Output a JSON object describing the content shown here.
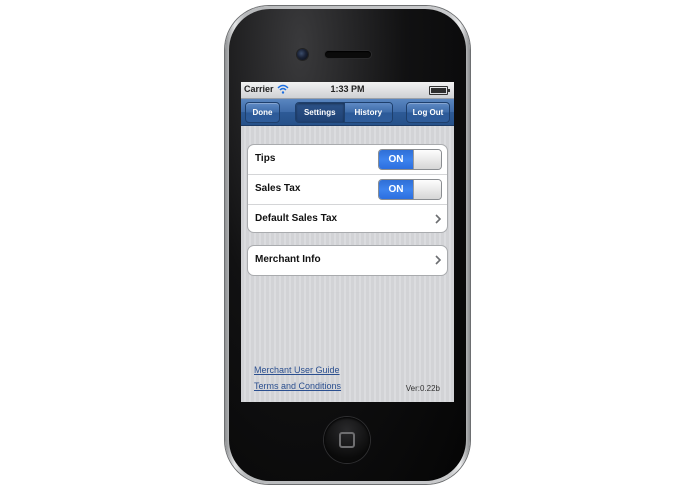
{
  "status_bar": {
    "carrier": "Carrier",
    "time": "1:33 PM"
  },
  "nav": {
    "done_label": "Done",
    "segments": [
      {
        "label": "Settings",
        "selected": true
      },
      {
        "label": "History",
        "selected": false
      }
    ],
    "logout_label": "Log Out"
  },
  "settings": {
    "rows": [
      {
        "label": "Tips",
        "toggle": "ON"
      },
      {
        "label": "Sales Tax",
        "toggle": "ON"
      },
      {
        "label": "Default Sales Tax"
      }
    ],
    "merchant_info": "Merchant Info"
  },
  "footer": {
    "user_guide": "Merchant User Guide",
    "terms": "Terms and Conditions",
    "version": "Ver:0.22b"
  },
  "colors": {
    "nav_blue": "#3e6ba8",
    "toggle_on": "#3d83ee",
    "link": "#2b4f8f"
  },
  "icons": [
    "camera-icon",
    "speaker-icon",
    "wifi-icon",
    "battery-icon",
    "chevron-right-icon",
    "home-button-icon"
  ]
}
